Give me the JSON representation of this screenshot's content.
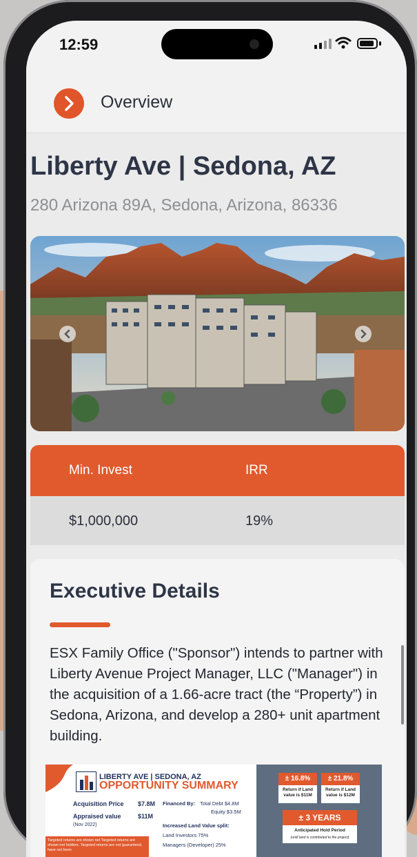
{
  "status_bar": {
    "time": "12:59"
  },
  "nav": {
    "title": "Overview"
  },
  "property": {
    "title": "Liberty Ave | Sedona, AZ",
    "address": "280 Arizona 89A, Sedona, Arizona, 86336"
  },
  "invest_table": {
    "headers": [
      "Min. Invest",
      "IRR"
    ],
    "values": [
      "$1,000,000",
      "19%"
    ]
  },
  "executive": {
    "title": "Executive Details",
    "body": "ESX Family Office (\"Sponsor\") intends to partner with Liberty Avenue Project Manager, LLC (\"Manager\") in the acquisition of a 1.66-acre tract (the “Property”) in Sedona, Arizona, and develop a 280+ unit apartment building."
  },
  "summary": {
    "title_top": "LIBERTY AVE | SEDONA, AZ",
    "title_main": "OPPORTUNITY SUMMARY",
    "acquisition_label": "Acquisition Price",
    "acquisition_value": "$7.8M",
    "appraised_label": "Appraised value",
    "appraised_value": "$11M",
    "appraised_date": "(Nov 2022)",
    "financed_label": "Financed By:",
    "financed_debt": "Total Debt $4.8M",
    "financed_equity": "Equity $3.5M",
    "split_label": "Increased Land Value split:",
    "split_investors": "Land Investors 75%",
    "split_managers": "Managers (Developer) 25%",
    "disclaimer": "Targeted returns are shown net Targeted returns are shown net holders. Targeted returns are not guaranteed, have not been",
    "box1_head": "± 16.8%",
    "box1_body": "Return if Land value is $11M",
    "box2_head": "± 21.8%",
    "box2_body": "Return if Land value is $12M",
    "box3_head": "± 3 YEARS",
    "box3_body": "Anticipated Hold Period",
    "box3_sub": "(until land is contributed to the project)"
  },
  "colors": {
    "accent": "#e05a2e",
    "navy": "#2e3546"
  }
}
